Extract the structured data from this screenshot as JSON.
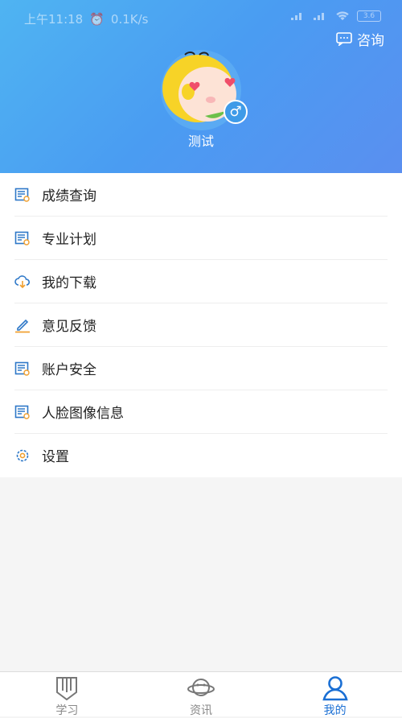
{
  "status_bar": {
    "time": "上午11:18",
    "speed": "0.1K/s",
    "battery": "3.6"
  },
  "header": {
    "consult_label": "咨询",
    "username": "测试",
    "gender_symbol": "♂"
  },
  "menu": {
    "items": [
      {
        "label": "成绩查询",
        "icon": "report-icon"
      },
      {
        "label": "专业计划",
        "icon": "report-icon"
      },
      {
        "label": "我的下载",
        "icon": "cloud-download-icon"
      },
      {
        "label": "意见反馈",
        "icon": "pencil-icon"
      },
      {
        "label": "账户安全",
        "icon": "report-icon"
      },
      {
        "label": "人脸图像信息",
        "icon": "report-icon"
      },
      {
        "label": "设置",
        "icon": "gear-icon"
      }
    ]
  },
  "tabbar": {
    "tabs": [
      {
        "label": "学习",
        "icon": "book-icon"
      },
      {
        "label": "资讯",
        "icon": "planet-icon"
      },
      {
        "label": "我的",
        "icon": "person-icon",
        "active": true
      }
    ]
  },
  "colors": {
    "header_start": "#4fb4f2",
    "header_end": "#5a8ff0",
    "active_tab": "#1a6fd4",
    "icon_blue": "#2e78c8",
    "icon_orange": "#f0a030"
  }
}
